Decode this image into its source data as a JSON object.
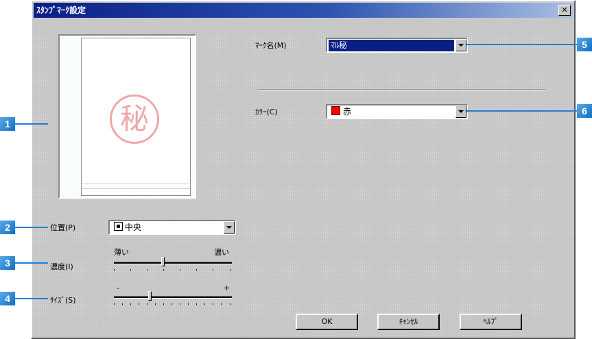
{
  "dialog": {
    "title": "ｽﾀﾝﾌﾟﾏｰｸ設定",
    "close_label": "✕"
  },
  "preview": {
    "stamp_text": "秘",
    "stamp_color": "#f1a7a7"
  },
  "position": {
    "label": "位置(P)",
    "value": "中央"
  },
  "density": {
    "label": "濃度(I)",
    "min_label": "薄い",
    "max_label": "濃い",
    "level": 0.41
  },
  "size": {
    "label": "ｻｲｽﾞ(S)",
    "min_label": "-",
    "max_label": "+",
    "level": 0.3
  },
  "mark_name": {
    "label": "ﾏｰｸ名(M)",
    "value": "ﾏﾙ秘"
  },
  "color": {
    "label": "ｶﾗｰ(C)",
    "value": "赤",
    "swatch": "#ff0000"
  },
  "buttons": {
    "ok": "OK",
    "cancel": "ｷｬﾝｾﾙ",
    "help": "ﾍﾙﾌﾟ"
  },
  "callouts": [
    "1",
    "2",
    "3",
    "4",
    "5",
    "6"
  ],
  "colors": {
    "callout": "#1f7fd0",
    "titlebar": "#0a1f86",
    "dialog_bg": "#c6c6c6"
  }
}
